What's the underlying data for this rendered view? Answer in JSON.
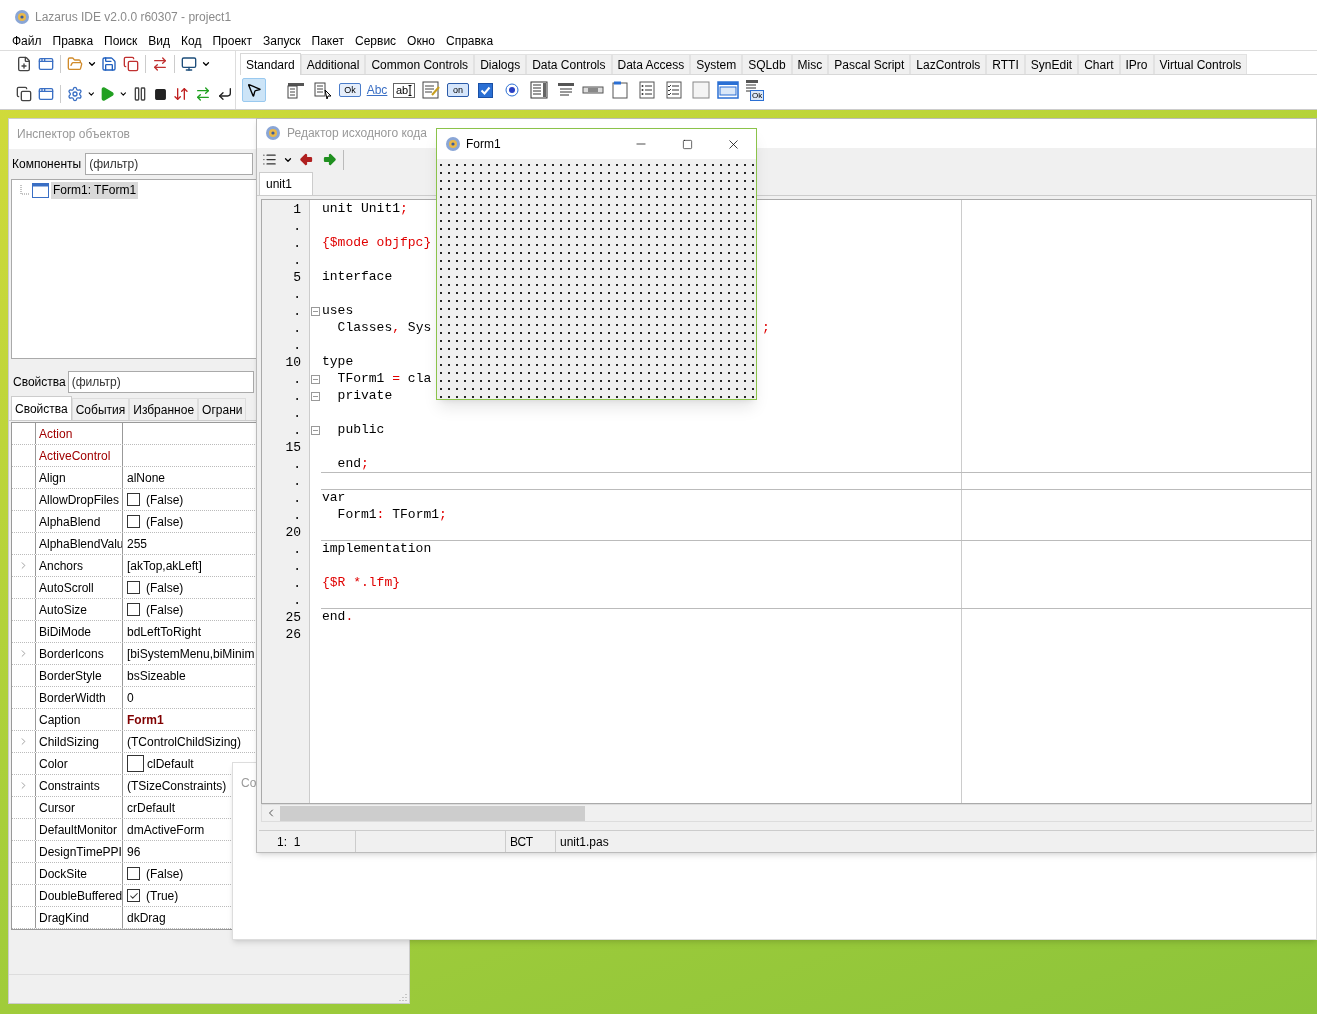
{
  "main_window": {
    "title": "Lazarus IDE v2.0.0 r60307 - project1",
    "menu": [
      "Файл",
      "Правка",
      "Поиск",
      "Вид",
      "Код",
      "Проект",
      "Запуск",
      "Пакет",
      "Сервис",
      "Окно",
      "Справка"
    ],
    "palette_tabs": [
      {
        "label": "Standard",
        "selected": true
      },
      {
        "label": "Additional",
        "selected": false
      },
      {
        "label": "Common Controls",
        "selected": false
      },
      {
        "label": "Dialogs",
        "selected": false
      },
      {
        "label": "Data Controls",
        "selected": false
      },
      {
        "label": "Data Access",
        "selected": false
      },
      {
        "label": "System",
        "selected": false
      },
      {
        "label": "SQLdb",
        "selected": false
      },
      {
        "label": "Misc",
        "selected": false
      },
      {
        "label": "Pascal Script",
        "selected": false
      },
      {
        "label": "LazControls",
        "selected": false
      },
      {
        "label": "RTTI",
        "selected": false
      },
      {
        "label": "SynEdit",
        "selected": false
      },
      {
        "label": "Chart",
        "selected": false
      },
      {
        "label": "IPro",
        "selected": false
      },
      {
        "label": "Virtual Controls",
        "selected": false
      }
    ],
    "palette_items": [
      {
        "kind": "pointer",
        "selected": true
      },
      {
        "kind": "mainmenu",
        "selected": false
      },
      {
        "kind": "popupmenu",
        "selected": false
      },
      {
        "kind": "button",
        "label": "Ok",
        "selected": false
      },
      {
        "kind": "label",
        "label": "Abc",
        "selected": false
      },
      {
        "kind": "edit",
        "label": "ab",
        "selected": false
      },
      {
        "kind": "memo",
        "selected": false
      },
      {
        "kind": "toggle",
        "label": "on",
        "selected": false
      },
      {
        "kind": "checkbox",
        "selected": false
      },
      {
        "kind": "radio",
        "selected": false
      },
      {
        "kind": "listbox",
        "selected": false
      },
      {
        "kind": "combobox",
        "selected": false
      },
      {
        "kind": "scrollbar",
        "selected": false
      },
      {
        "kind": "groupbox",
        "selected": false
      },
      {
        "kind": "radiogroup",
        "selected": false
      },
      {
        "kind": "checkgroup",
        "selected": false
      },
      {
        "kind": "panel",
        "selected": false
      },
      {
        "kind": "frame",
        "selected": false
      },
      {
        "kind": "actionlist",
        "label": "Ok",
        "selected": false
      }
    ]
  },
  "inspector": {
    "title": "Инспектор объектов",
    "components_label": "Компоненты",
    "components_filter": {
      "placeholder": "(фильтр)"
    },
    "tree": [
      {
        "label": "Form1: TForm1",
        "selected": true
      }
    ],
    "properties_label": "Свойства",
    "properties_filter": {
      "placeholder": "(фильтр)"
    },
    "tabs": [
      {
        "label": "Свойства",
        "selected": true
      },
      {
        "label": "События",
        "selected": false
      },
      {
        "label": "Избранное",
        "selected": false
      },
      {
        "label": "Ограни",
        "selected": false
      }
    ],
    "rows": [
      {
        "name": "Action",
        "kind": "text",
        "linked": true,
        "expandable": false
      },
      {
        "name": "ActiveControl",
        "kind": "text",
        "linked": true,
        "expandable": false
      },
      {
        "name": "Align",
        "value": "alNone",
        "kind": "text",
        "linked": false,
        "expandable": false
      },
      {
        "name": "AllowDropFiles",
        "value": "(False)",
        "kind": "checkbox",
        "checked": false,
        "linked": false,
        "expandable": false
      },
      {
        "name": "AlphaBlend",
        "value": "(False)",
        "kind": "checkbox",
        "checked": false,
        "linked": false,
        "expandable": false
      },
      {
        "name": "AlphaBlendValu",
        "value": "255",
        "kind": "text",
        "linked": false,
        "expandable": false
      },
      {
        "name": "Anchors",
        "value": "[akTop,akLeft]",
        "kind": "text",
        "linked": false,
        "expandable": true
      },
      {
        "name": "AutoScroll",
        "value": "(False)",
        "kind": "checkbox",
        "checked": false,
        "linked": false,
        "expandable": false
      },
      {
        "name": "AutoSize",
        "value": "(False)",
        "kind": "checkbox",
        "checked": false,
        "linked": false,
        "expandable": false
      },
      {
        "name": "BiDiMode",
        "value": "bdLeftToRight",
        "kind": "text",
        "linked": false,
        "expandable": false
      },
      {
        "name": "BorderIcons",
        "value": "[biSystemMenu,biMinim",
        "kind": "text",
        "linked": false,
        "expandable": true
      },
      {
        "name": "BorderStyle",
        "value": "bsSizeable",
        "kind": "text",
        "linked": false,
        "expandable": false
      },
      {
        "name": "BorderWidth",
        "value": "0",
        "kind": "text",
        "linked": false,
        "expandable": false
      },
      {
        "name": "Caption",
        "value": "Form1",
        "kind": "modified",
        "linked": false,
        "expandable": false
      },
      {
        "name": "ChildSizing",
        "value": "(TControlChildSizing)",
        "kind": "text",
        "linked": false,
        "expandable": true
      },
      {
        "name": "Color",
        "value": "clDefault",
        "kind": "color",
        "color": "#ffffff",
        "linked": false,
        "expandable": false
      },
      {
        "name": "Constraints",
        "value": "(TSizeConstraints)",
        "kind": "text",
        "linked": false,
        "expandable": true
      },
      {
        "name": "Cursor",
        "value": "crDefault",
        "kind": "text",
        "linked": false,
        "expandable": false
      },
      {
        "name": "DefaultMonitor",
        "value": "dmActiveForm",
        "kind": "text",
        "linked": false,
        "expandable": false
      },
      {
        "name": "DesignTimePPI",
        "value": "96",
        "kind": "text",
        "linked": false,
        "expandable": false
      },
      {
        "name": "DockSite",
        "value": "(False)",
        "kind": "checkbox",
        "checked": false,
        "linked": false,
        "expandable": false
      },
      {
        "name": "DoubleBuffered",
        "value": "(True)",
        "kind": "checkbox",
        "checked": true,
        "linked": false,
        "expandable": false
      },
      {
        "name": "DragKind",
        "value": "dkDrag",
        "kind": "text",
        "linked": false,
        "expandable": false
      }
    ]
  },
  "back_window": {
    "title": "Co"
  },
  "editor": {
    "title": "Редактор исходного кода",
    "tabs": [
      {
        "label": "unit1",
        "selected": true
      }
    ],
    "lines": [
      {
        "num": "1",
        "text": "unit Unit1;",
        "kind": "code"
      },
      {
        "num": "."
      },
      {
        "num": ".",
        "text": "{$mode objfpc}",
        "kind": "directive"
      },
      {
        "num": "."
      },
      {
        "num": "5",
        "text": "interface",
        "kind": "code"
      },
      {
        "num": "."
      },
      {
        "num": ".",
        "text": "uses",
        "kind": "code",
        "fold": true
      },
      {
        "num": ".",
        "text": "  Classes, Sys",
        "kind": "code",
        "tail": ";"
      },
      {
        "num": "."
      },
      {
        "num": "10",
        "text": "type",
        "kind": "code"
      },
      {
        "num": ".",
        "text": "  TForm1 = cla",
        "kind": "code",
        "fold": true
      },
      {
        "num": ".",
        "text": "  private",
        "kind": "code",
        "fold": true
      },
      {
        "num": "."
      },
      {
        "num": ".",
        "text": "  public",
        "kind": "code",
        "fold": true
      },
      {
        "num": "15"
      },
      {
        "num": ".",
        "text": "  end;",
        "kind": "code",
        "divider": true
      },
      {
        "num": ".",
        "divider": true
      },
      {
        "num": ".",
        "text": "var",
        "kind": "code"
      },
      {
        "num": ".",
        "text": "  Form1: TForm1;",
        "kind": "code"
      },
      {
        "num": "20",
        "divider": true
      },
      {
        "num": ".",
        "text": "implementation",
        "kind": "code"
      },
      {
        "num": "."
      },
      {
        "num": ".",
        "text": "{$R *.lfm}",
        "kind": "directive"
      },
      {
        "num": ".",
        "divider": true
      },
      {
        "num": "25",
        "text": "end.",
        "kind": "code"
      },
      {
        "num": "26"
      }
    ],
    "status": {
      "position": "1:  1",
      "mode": "ВСТ",
      "file": "unit1.pas"
    }
  },
  "form": {
    "title": "Form1"
  }
}
